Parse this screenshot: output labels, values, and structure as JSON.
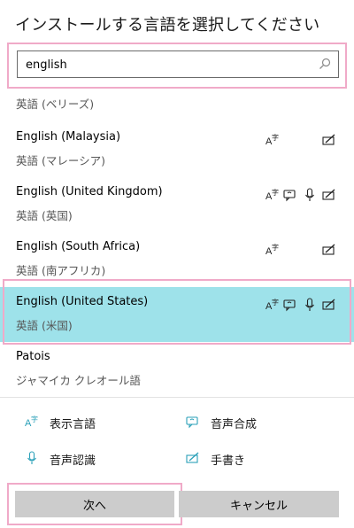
{
  "dialog": {
    "title": "インストールする言語を選択してください"
  },
  "search": {
    "value": "english"
  },
  "list": {
    "partial_sub": "英語 (ベリーズ)",
    "items": [
      {
        "name": "English (Malaysia)",
        "sub": "英語 (マレーシア)",
        "features": [
          "display-language"
        ]
      },
      {
        "name": "English (United Kingdom)",
        "sub": "英語 (英国)",
        "features": [
          "display-language",
          "speech-synthesis",
          "speech-recognition",
          "handwriting"
        ]
      },
      {
        "name": "English (South Africa)",
        "sub": "英語 (南アフリカ)",
        "features": [
          "display-language"
        ]
      },
      {
        "name": "English (United States)",
        "sub": "英語 (米国)",
        "features": [
          "display-language",
          "speech-synthesis",
          "speech-recognition",
          "handwriting"
        ],
        "selected": true
      },
      {
        "name": "Patois",
        "sub": "ジャマイカ クレオール語",
        "features": []
      }
    ]
  },
  "legend": {
    "display_language": "表示言語",
    "speech_synthesis": "音声合成",
    "speech_recognition": "音声認識",
    "handwriting": "手書き"
  },
  "buttons": {
    "next": "次へ",
    "cancel": "キャンセル"
  },
  "colors": {
    "selected_row": "#9ee2ea",
    "highlight_border": "#f0aac8",
    "icon_accent": "#2aa0b8"
  }
}
